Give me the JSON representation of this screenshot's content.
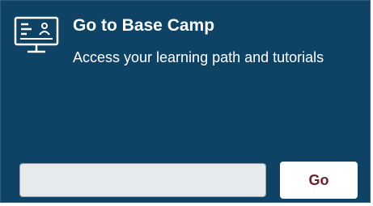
{
  "card": {
    "title": "Go to Base Camp",
    "subtitle": "Access your learning path and tutorials",
    "icon": "computer-monitor-icon"
  },
  "form": {
    "input_placeholder": "",
    "go_label": "Go"
  },
  "colors": {
    "card_background": "#0f4366",
    "title_text": "#ffffff",
    "button_text": "#6b1f2b"
  }
}
